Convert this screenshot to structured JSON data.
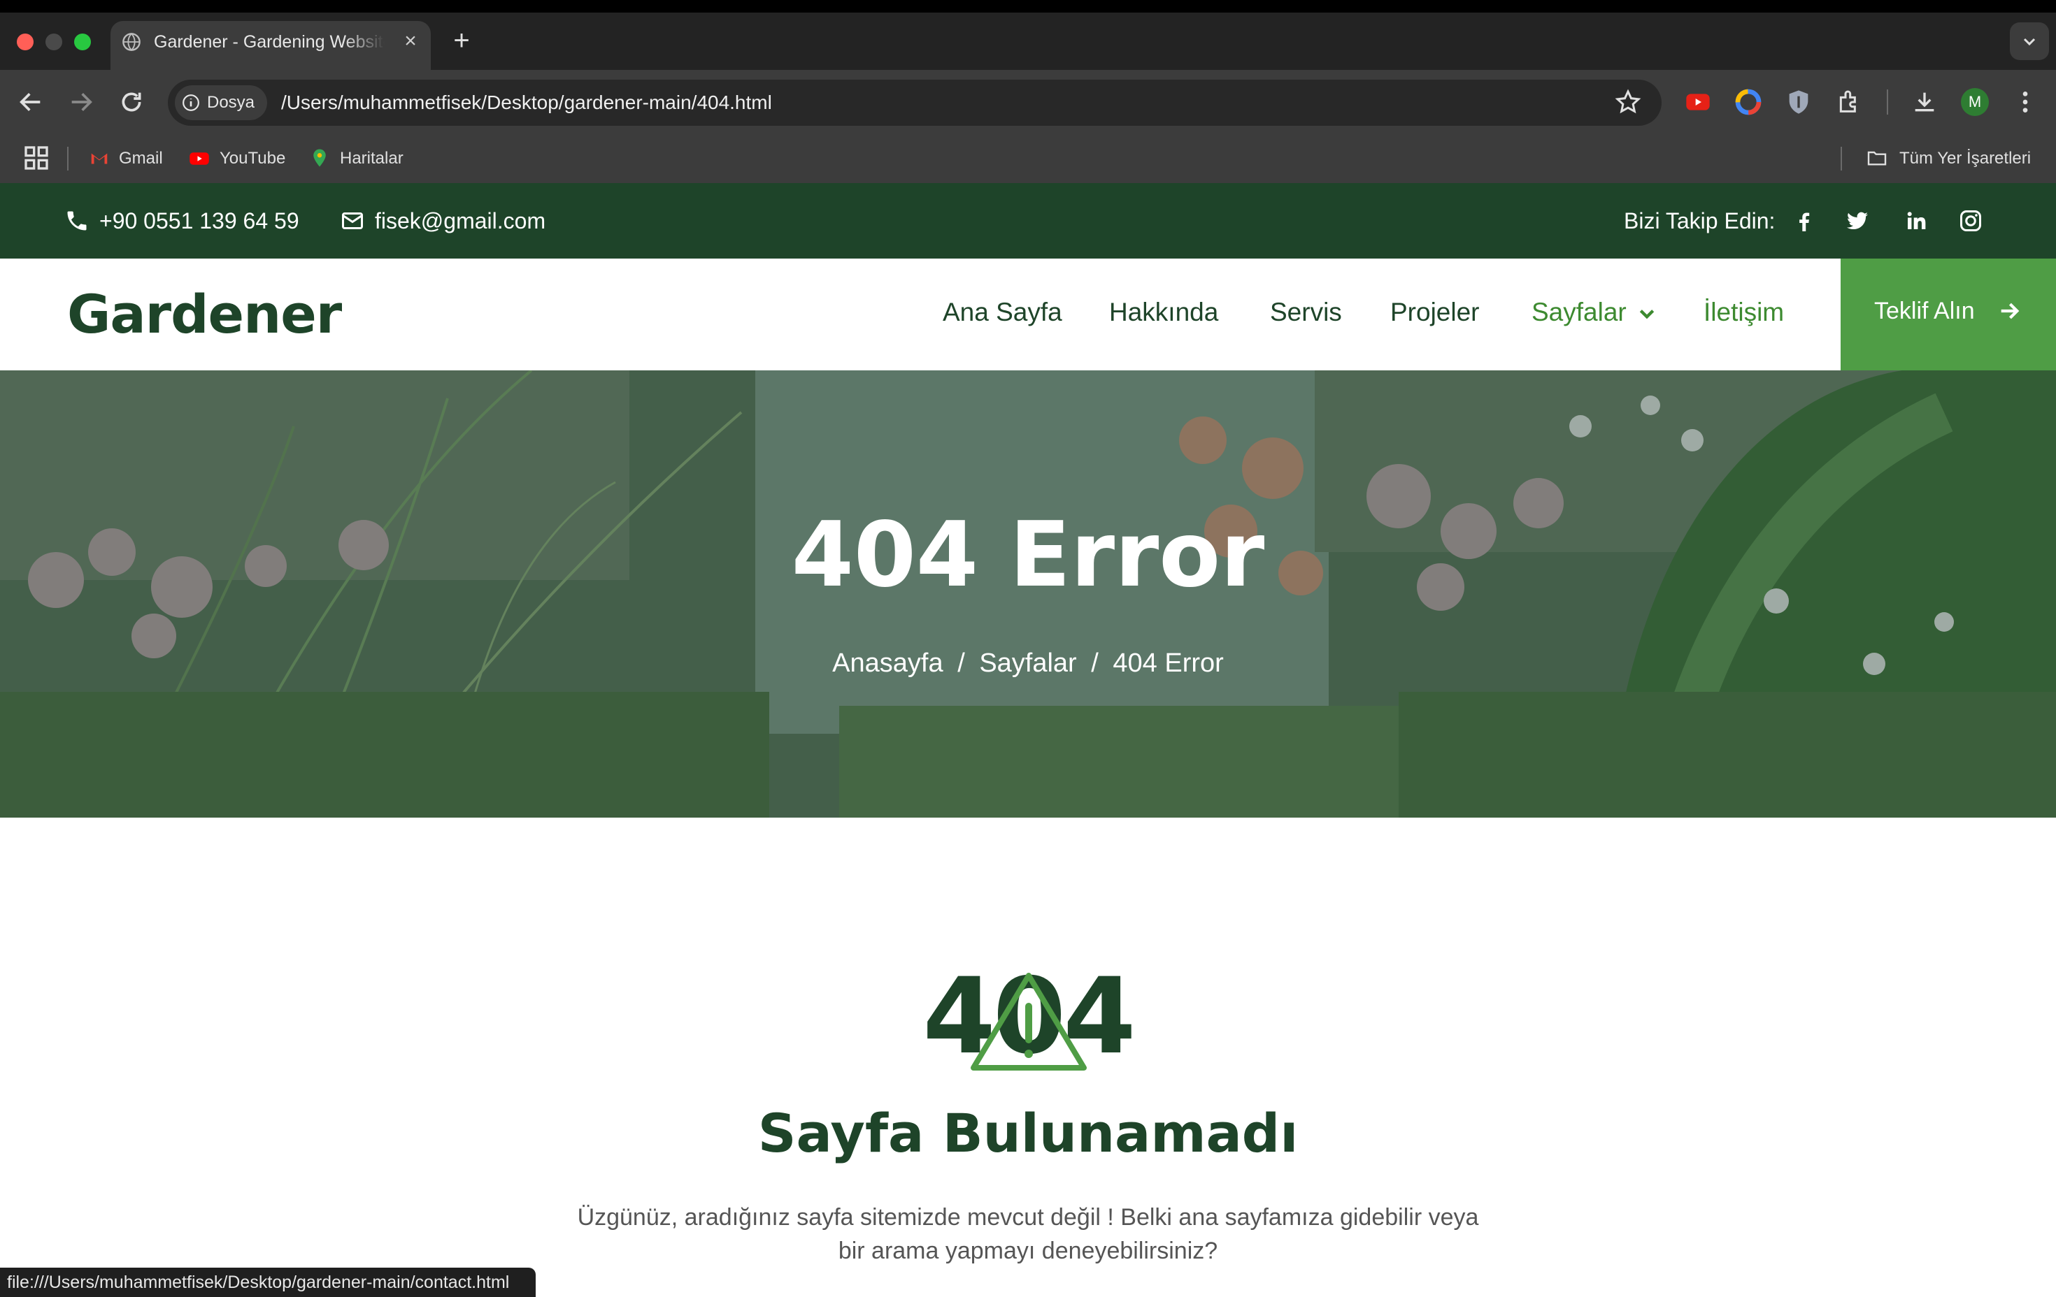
{
  "browser": {
    "tab_title": "Gardener - Gardening Website",
    "tab_close": "×",
    "new_tab": "+",
    "security_chip": "Dosya",
    "url": "/Users/muhammetfisek/Desktop/gardener-main/404.html",
    "bookmarks": [
      {
        "label": "Gmail",
        "icon": "gmail-icon"
      },
      {
        "label": "YouTube",
        "icon": "youtube-icon"
      },
      {
        "label": "Haritalar",
        "icon": "maps-icon"
      }
    ],
    "all_bookmarks": "Tüm Yer İşaretleri",
    "profile_initial": "M",
    "status_url": "file:///Users/muhammetfisek/Desktop/gardener-main/contact.html"
  },
  "topbar": {
    "phone": "+90 0551 139 64 59",
    "email": "fisek@gmail.com",
    "follow_label": "Bizi Takip Edin:",
    "socials": [
      "facebook-icon",
      "twitter-icon",
      "linkedin-icon",
      "instagram-icon"
    ]
  },
  "nav": {
    "logo": "Gardener",
    "items": [
      "Ana Sayfa",
      "Hakkında",
      "Servis",
      "Projeler",
      "Sayfalar",
      "İletişim"
    ],
    "cta": "Teklif Alın"
  },
  "hero": {
    "title": "404 Error",
    "crumbs": [
      "Anasayfa",
      "Sayfalar",
      "404 Error"
    ],
    "separator": "/"
  },
  "content": {
    "code": "404",
    "title": "Sayfa Bulunamadı",
    "text": "Üzgünüz, aradığınız sayfa sitemizde mevcut değil ! Belki ana sayfamıza gidebilir veya bir arama yapmayı deneyebilirsiniz?"
  },
  "colors": {
    "brand_dark": "#1e4429",
    "brand_green": "#4f9d45",
    "active_nav": "#3d8a30"
  }
}
